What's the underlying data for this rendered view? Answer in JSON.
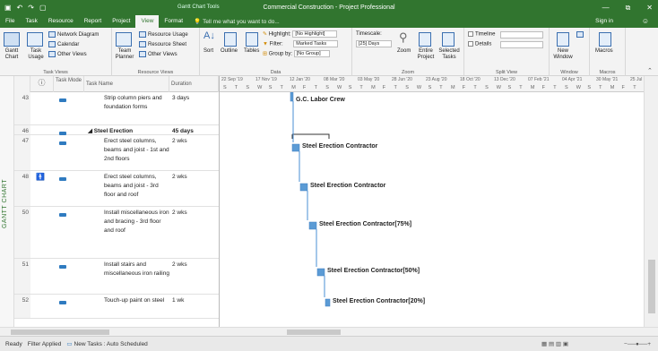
{
  "titlebar": {
    "context_tab": "Gantt Chart Tools",
    "window_title": "Commercial Construction - Project Professional",
    "controls": [
      "—",
      "⧉",
      "✕"
    ]
  },
  "menu": {
    "tabs": [
      "File",
      "Task",
      "Resource",
      "Report",
      "Project",
      "View",
      "Format"
    ],
    "active": "View",
    "tell_me": "Tell me what you want to do...",
    "sign_in": "Sign in"
  },
  "ribbon": {
    "task_views": {
      "label": "Task Views",
      "gantt": "Gantt Chart",
      "task_usage": "Task Usage",
      "network_diagram": "Network Diagram",
      "calendar": "Calendar",
      "other_views": "Other Views"
    },
    "resource_views": {
      "label": "Resource Views",
      "team_planner": "Team Planner",
      "resource_usage": "Resource Usage",
      "resource_sheet": "Resource Sheet",
      "other_views": "Other Views"
    },
    "data": {
      "label": "Data",
      "sort": "Sort",
      "outline": "Outline",
      "tables": "Tables",
      "highlight_label": "Highlight:",
      "highlight_value": "[No Highlight]",
      "filter_label": "Filter:",
      "filter_value": "Marked Tasks",
      "group_label": "Group by:",
      "group_value": "[No Group]"
    },
    "zoom": {
      "label": "Zoom",
      "timescale_label": "Timescale:",
      "timescale_value": "[25] Days",
      "zoom": "Zoom",
      "entire_project": "Entire Project",
      "selected_tasks": "Selected Tasks"
    },
    "split_view": {
      "label": "Split View",
      "timeline": "Timeline",
      "details": "Details"
    },
    "window": {
      "label": "Window",
      "new_window": "New Window"
    },
    "macros": {
      "label": "Macros",
      "macros": "Macros"
    }
  },
  "side_label": "GANTT CHART",
  "table": {
    "headers": {
      "info": "ⓘ",
      "mode": "Task Mode",
      "name": "Task Name",
      "duration": "Duration"
    },
    "rows": [
      {
        "id": "43",
        "name": "Strip column piers and foundation forms",
        "duration": "3 days",
        "summary": false,
        "indicator": ""
      },
      {
        "id": "46",
        "name": "◢ Steel Erection",
        "duration": "45 days",
        "summary": true,
        "indicator": ""
      },
      {
        "id": "47",
        "name": "Erect steel columns, beams and joist - 1st and 2nd floors",
        "duration": "2 wks",
        "summary": false,
        "indicator": ""
      },
      {
        "id": "48",
        "name": "Erect steel columns, beams and joist - 3rd floor and roof",
        "duration": "2 wks",
        "summary": false,
        "indicator": "person-icon"
      },
      {
        "id": "50",
        "name": "Install miscellaneous iron and bracing - 3rd floor and roof",
        "duration": "2 wks",
        "summary": false,
        "indicator": ""
      },
      {
        "id": "51",
        "name": "Install stairs and miscellaneous iron railing",
        "duration": "2 wks",
        "summary": false,
        "indicator": ""
      },
      {
        "id": "52",
        "name": "Touch-up paint on steel",
        "duration": "1 wk",
        "summary": false,
        "indicator": ""
      }
    ]
  },
  "timescale": {
    "top": [
      "22 Sep '19",
      "17 Nov '19",
      "12 Jan '20",
      "08 Mar '20",
      "03 May '20",
      "28 Jun '20",
      "23 Aug '20",
      "18 Oct '20",
      "13 Dec '20",
      "07 Feb '21",
      "04 Apr '21",
      "30 May '21",
      "25 Jul '21"
    ],
    "bottom": [
      "S",
      "T",
      "S",
      "W",
      "S",
      "T",
      "M",
      "F",
      "T",
      "S",
      "W",
      "S",
      "T",
      "M",
      "F",
      "T",
      "S",
      "W",
      "S",
      "T",
      "M",
      "F",
      "T",
      "S",
      "W",
      "S",
      "T",
      "M",
      "F",
      "T",
      "S",
      "W",
      "S",
      "T",
      "M",
      "F",
      "T",
      "S",
      "W"
    ]
  },
  "bars": [
    {
      "label": "G.C. Labor Crew"
    },
    {
      "label": "Steel Erection Contractor"
    },
    {
      "label": "Steel Erection Contractor"
    },
    {
      "label": "Steel Erection Contractor[75%]"
    },
    {
      "label": "Steel Erection Contractor[50%]"
    },
    {
      "label": "Steel Erection Contractor[20%]"
    }
  ],
  "status": {
    "ready": "Ready",
    "filter": "Filter Applied",
    "new_tasks": "New Tasks : Auto Scheduled"
  }
}
